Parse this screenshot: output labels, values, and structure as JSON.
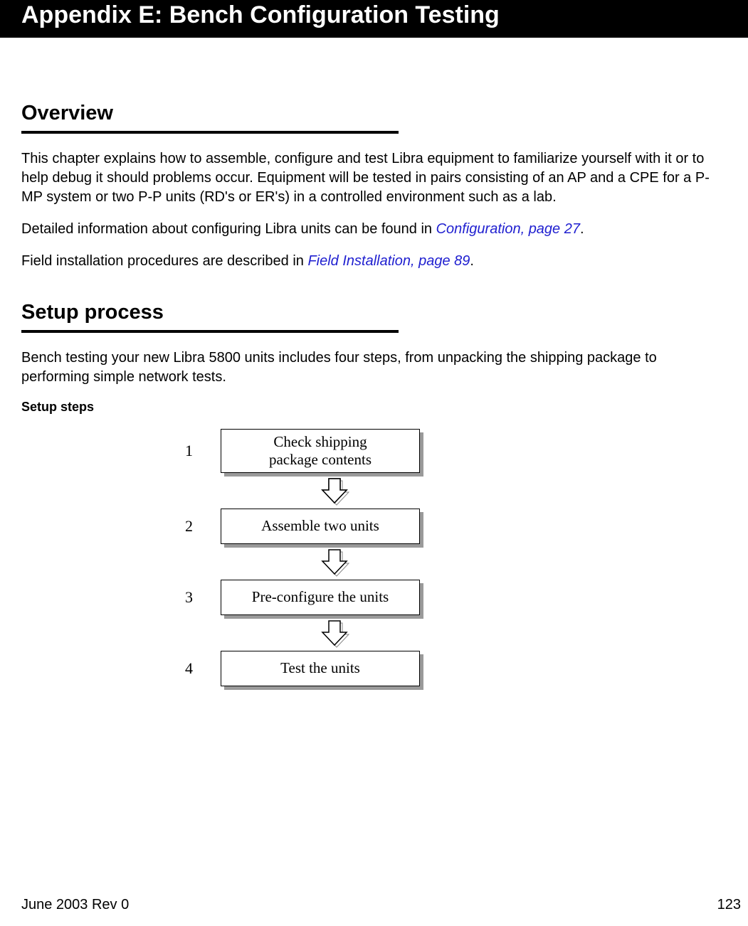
{
  "header": {
    "title": "Appendix E: Bench Configuration Testing"
  },
  "overview": {
    "heading": "Overview",
    "para1": "This chapter explains how to assemble, configure and test Libra equipment to familiarize yourself with it or to help debug it should problems occur. Equipment will be tested in pairs consisting of an AP and a CPE for a P-MP system or two P-P units (RD's or ER's) in a controlled environment such as a lab.",
    "para2_pre": "Detailed information about configuring Libra units can be found in ",
    "para2_link": "Configuration, page 27",
    "para2_post": ".",
    "para3_pre": "Field installation procedures are described in ",
    "para3_link": "Field Installation, page 89",
    "para3_post": "."
  },
  "setup": {
    "heading": "Setup process",
    "intro": "Bench testing your new Libra 5800 units includes four steps, from unpacking the shipping package to performing simple network tests.",
    "figure_label": "Setup steps",
    "steps": [
      {
        "num": "1",
        "label": "Check shipping\npackage contents"
      },
      {
        "num": "2",
        "label": "Assemble two units"
      },
      {
        "num": "3",
        "label": "Pre-configure the units"
      },
      {
        "num": "4",
        "label": "Test the units"
      }
    ]
  },
  "footer": {
    "left": "June 2003 Rev 0",
    "right": "123"
  }
}
